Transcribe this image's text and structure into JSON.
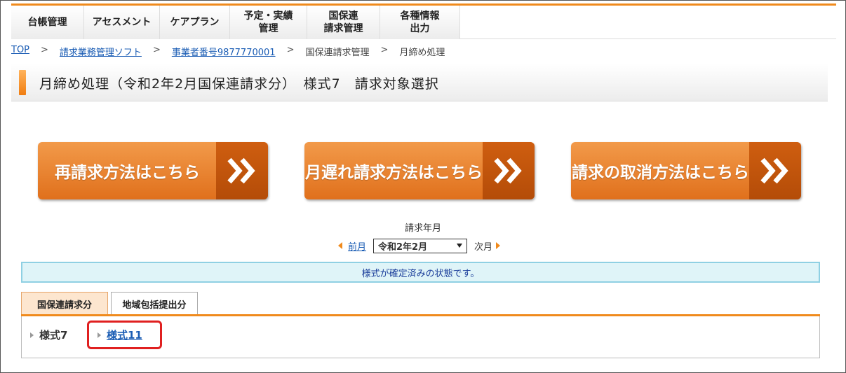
{
  "nav": {
    "items": [
      {
        "label": "台帳管理"
      },
      {
        "label": "アセスメント"
      },
      {
        "label": "ケアプラン"
      },
      {
        "label": "予定・実績\n管理"
      },
      {
        "label": "国保連\n請求管理"
      },
      {
        "label": "各種情報\n出力"
      }
    ]
  },
  "breadcrumb": {
    "top": "TOP",
    "soft": "請求業務管理ソフト",
    "office": "事業者番号9877770001",
    "kokuho": "国保連請求管理",
    "current": "月締め処理",
    "separator": ">"
  },
  "page": {
    "title": "月締め処理（令和2年2月国保連請求分）　様式7　請求対象選択"
  },
  "actions": {
    "rebill": "再請求方法はこちら",
    "late_bill": "月遅れ請求方法はこちら",
    "cancel_bill": "請求の取消方法はこちら",
    "arrow_icon": "double-chevron-right-icon"
  },
  "billing_month": {
    "label": "請求年月",
    "prev": "前月",
    "selected": "令和2年2月",
    "next": "次月"
  },
  "notice": {
    "text": "様式が確定済みの状態です。"
  },
  "tabs": [
    {
      "label": "国保連請求分",
      "active": true
    },
    {
      "label": "地域包括提出分",
      "active": false
    }
  ],
  "forms": {
    "form7": "様式7",
    "form11": "様式11"
  },
  "colors": {
    "accent": "#f08a1c",
    "button": "#e8822e",
    "link": "#1a5cb4",
    "notice_bg": "#dff4f8",
    "highlight": "#e02020"
  }
}
